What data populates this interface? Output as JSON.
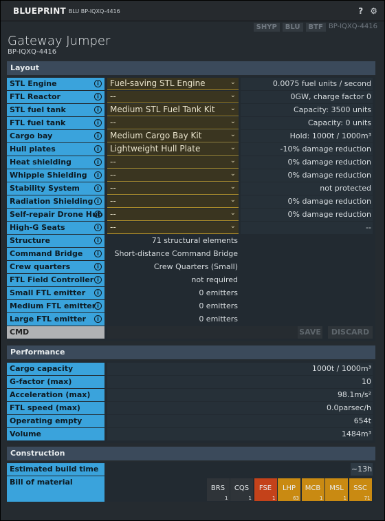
{
  "titlebar": {
    "title": "BLUEPRINT",
    "subtitle": "BLU BP-IQXQ-4416",
    "help_icon": "?",
    "settings_icon": "⚙"
  },
  "tags": [
    "SHYP",
    "BLU",
    "BTF",
    "BP-IQXQ-4416"
  ],
  "ship": {
    "name": "Gateway Jumper",
    "id": "BP-IQXQ-4416"
  },
  "layout": {
    "title": "Layout",
    "rows": [
      {
        "label": "STL Engine",
        "select": "Fuel-saving STL Engine",
        "value": "0.0075 fuel units / second"
      },
      {
        "label": "FTL Reactor",
        "select": "--",
        "value": "0GW, charge factor 0"
      },
      {
        "label": "STL fuel tank",
        "select": "Medium STL Fuel Tank Kit",
        "value": "Capacity: 3500 units"
      },
      {
        "label": "FTL fuel tank",
        "select": "--",
        "value": "Capacity: 0 units"
      },
      {
        "label": "Cargo bay",
        "select": "Medium Cargo Bay Kit",
        "value": "Hold: 1000t / 1000m³"
      },
      {
        "label": "Hull plates",
        "select": "Lightweight Hull Plate",
        "value": "-10% damage reduction"
      },
      {
        "label": "Heat shielding",
        "select": "--",
        "value": "0% damage reduction"
      },
      {
        "label": "Whipple Shielding",
        "select": "--",
        "value": "0% damage reduction"
      },
      {
        "label": "Stability System",
        "select": "--",
        "value": "not protected"
      },
      {
        "label": "Radiation Shielding",
        "select": "--",
        "value": "0% damage reduction"
      },
      {
        "label": "Self-repair Drone Hub",
        "select": "--",
        "value": "0% damage reduction"
      },
      {
        "label": "High-G Seats",
        "select": "--",
        "value": "--"
      }
    ],
    "computed_rows": [
      {
        "label": "Structure",
        "value": "71 structural elements"
      },
      {
        "label": "Command Bridge",
        "value": "Short-distance Command Bridge"
      },
      {
        "label": "Crew quarters",
        "value": "Crew Quarters (Small)"
      },
      {
        "label": "FTL Field Controller",
        "value": "not required"
      },
      {
        "label": "Small FTL emitter",
        "value": "0 emitters"
      },
      {
        "label": "Medium FTL emitter",
        "value": "0 emitters"
      },
      {
        "label": "Large FTL emitter",
        "value": "0 emitters"
      }
    ],
    "cmd_label": "CMD",
    "save_label": "SAVE",
    "discard_label": "DISCARD"
  },
  "performance": {
    "title": "Performance",
    "rows": [
      {
        "label": "Cargo capacity",
        "value": "1000t / 1000m³"
      },
      {
        "label": "G-factor (max)",
        "value": "10"
      },
      {
        "label": "Acceleration (max)",
        "value": "98.1m/s²"
      },
      {
        "label": "FTL speed (max)",
        "value": "0.0parsec/h"
      },
      {
        "label": "Operating empty mass",
        "value": "654t"
      },
      {
        "label": "Volume",
        "value": "1484m³"
      }
    ]
  },
  "construction": {
    "title": "Construction",
    "build_time_label": "Estimated build time",
    "build_time": "~13h",
    "bom_label": "Bill of material",
    "bom": [
      {
        "ticker": "BRS",
        "qty": "1",
        "color": "#2f3439"
      },
      {
        "ticker": "CQS",
        "qty": "1",
        "color": "#2f3439"
      },
      {
        "ticker": "FSE",
        "qty": "1",
        "color": "#c4421a"
      },
      {
        "ticker": "LHP",
        "qty": "63",
        "color": "#c98a12"
      },
      {
        "ticker": "MCB",
        "qty": "1",
        "color": "#c98a12"
      },
      {
        "ticker": "MSL",
        "qty": "1",
        "color": "#c98a12"
      },
      {
        "ticker": "SSC",
        "qty": "71",
        "color": "#c98a12"
      }
    ]
  }
}
